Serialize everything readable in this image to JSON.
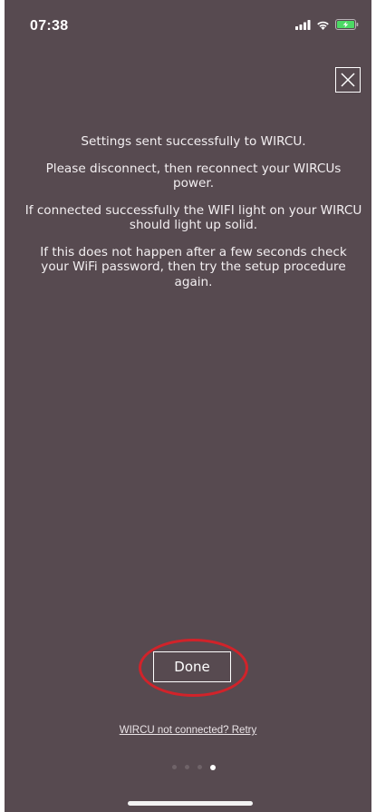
{
  "status_bar": {
    "time": "07:38",
    "icons": [
      "signal-icon",
      "wifi-icon",
      "battery-charging-icon"
    ],
    "battery_color": "#4cd964"
  },
  "close": {
    "icon": "close-icon"
  },
  "message": {
    "line1": "Settings sent successfully to WIRCU.",
    "line2": "Please disconnect, then reconnect your WIRCUs power.",
    "line3": "If connected successfully the WIFI light on your WIRCU should light up solid.",
    "line4": "If this does not happen after a few seconds check your WiFi password, then try the setup procedure again."
  },
  "done_button": {
    "label": "Done",
    "highlight_color": "#d1232a"
  },
  "retry": {
    "label": "WIRCU not connected? Retry"
  },
  "pager": {
    "total": 4,
    "active_index": 3
  },
  "colors": {
    "background": "#574a50",
    "text": "#ffffff"
  }
}
